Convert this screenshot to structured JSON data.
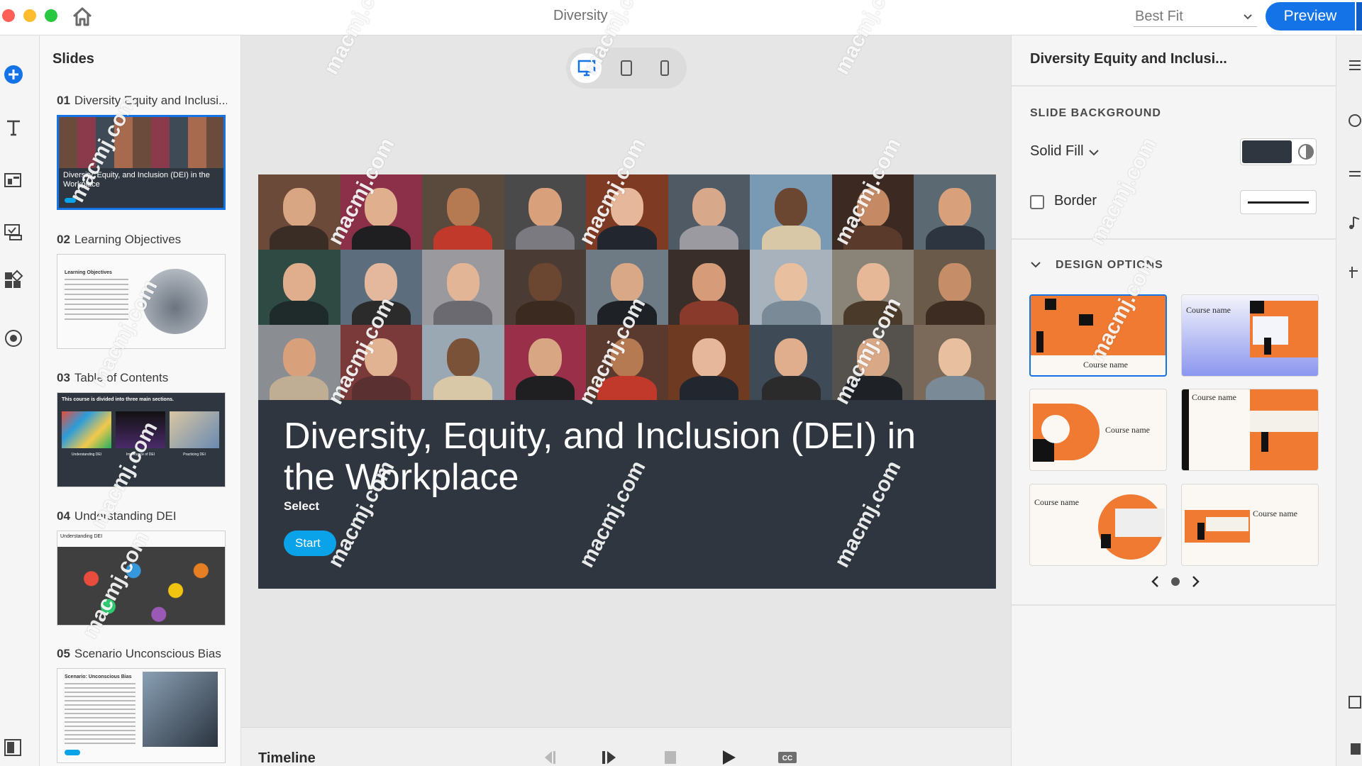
{
  "window": {
    "title": "Diversity",
    "zoom": "Best Fit",
    "preview_label": "Preview"
  },
  "slides_panel": {
    "title": "Slides",
    "items": [
      {
        "num": "01",
        "title": "Diversity Equity and Inclusi...",
        "thumb_text": "Diversity, Equity, and Inclusion (DEI) in the Workplace",
        "selected": true
      },
      {
        "num": "02",
        "title": "Learning Objectives",
        "thumb_text": "Learning Objectives"
      },
      {
        "num": "03",
        "title": "Table of Contents",
        "thumb_text": "This course is divided into three main sections.",
        "thumb_sub": [
          "Understanding DEI",
          "Importance of DEI",
          "Practicing DEI"
        ]
      },
      {
        "num": "04",
        "title": "Understanding DEI",
        "thumb_text": "Understanding DEI"
      },
      {
        "num": "05",
        "title": "Scenario Unconscious Bias",
        "thumb_text": "Scenario: Unconscious Bias"
      }
    ]
  },
  "canvas": {
    "heading": "Diversity, Equity, and Inclusion (DEI) in the Workplace",
    "subtitle": "Select",
    "start_label": "Start"
  },
  "timeline": {
    "label": "Timeline"
  },
  "properties": {
    "title": "Diversity Equity and Inclusi...",
    "background_section": "SLIDE BACKGROUND",
    "fill_type": "Solid Fill",
    "fill_color": "#2f3640",
    "border_label": "Border",
    "border_checked": false,
    "design_section": "DESIGN OPTIONS",
    "themes": [
      "Course name",
      "Course name",
      "Course name",
      "Course name",
      "Course name",
      "Course name"
    ],
    "page_current": 1,
    "page_total": 1
  },
  "watermark": "macmj.com",
  "colors": {
    "accent": "#1473e6",
    "slide_bg": "#2f3640",
    "theme_orange": "#f07a32",
    "start_button": "#0aa2e8"
  }
}
